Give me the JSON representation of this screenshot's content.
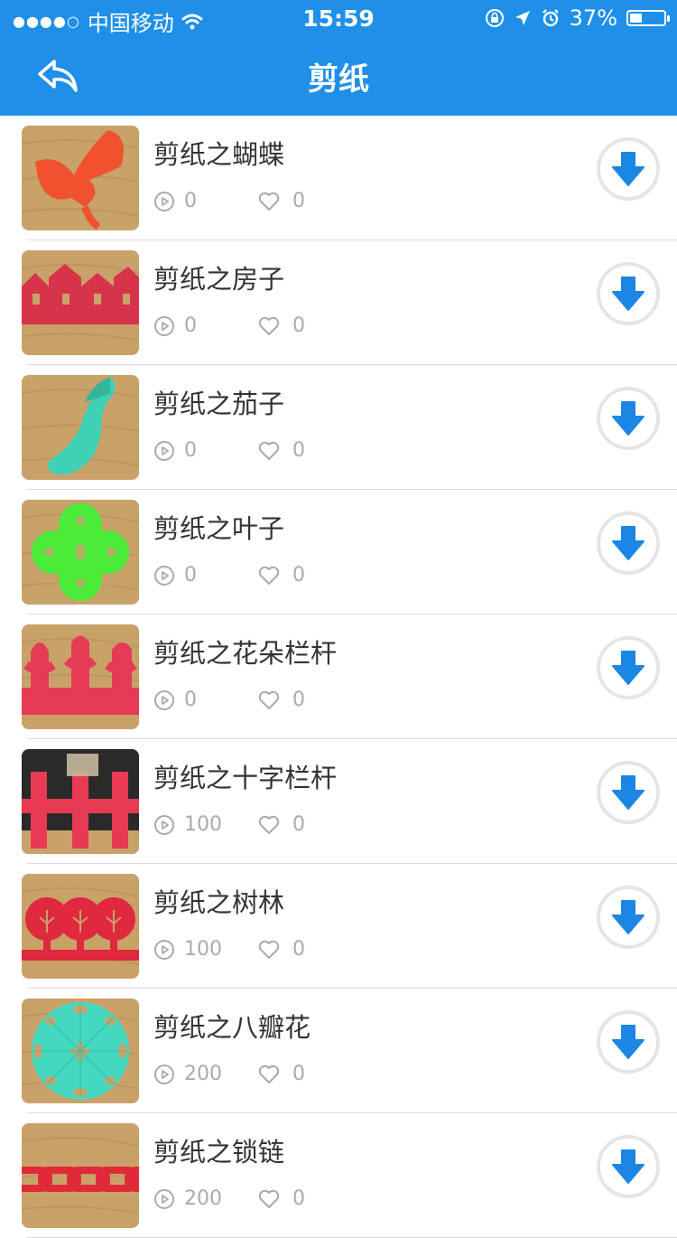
{
  "status_bar": {
    "carrier": "中国移动",
    "time": "15:59",
    "battery_percent": "37%",
    "battery_level": 0.37,
    "signal_dots": "●●●●○"
  },
  "nav": {
    "title": "剪纸",
    "back_icon": "back-arrow-icon"
  },
  "items": [
    {
      "title": "剪纸之蝴蝶",
      "plays": "0",
      "likes": "0",
      "thumb": "butterfly",
      "color": "#f0522f"
    },
    {
      "title": "剪纸之房子",
      "plays": "0",
      "likes": "0",
      "thumb": "house",
      "color": "#d7334a"
    },
    {
      "title": "剪纸之茄子",
      "plays": "0",
      "likes": "0",
      "thumb": "eggplant",
      "color": "#3fd1b6"
    },
    {
      "title": "剪纸之叶子",
      "plays": "0",
      "likes": "0",
      "thumb": "leaf",
      "color": "#4cec3b"
    },
    {
      "title": "剪纸之花朵栏杆",
      "plays": "0",
      "likes": "0",
      "thumb": "flower-fence",
      "color": "#e53b55"
    },
    {
      "title": "剪纸之十字栏杆",
      "plays": "100",
      "likes": "0",
      "thumb": "cross-fence",
      "color": "#e83a52"
    },
    {
      "title": "剪纸之树林",
      "plays": "100",
      "likes": "0",
      "thumb": "trees",
      "color": "#e0283e"
    },
    {
      "title": "剪纸之八瓣花",
      "plays": "200",
      "likes": "0",
      "thumb": "eight-petal",
      "color": "#42d9c0"
    },
    {
      "title": "剪纸之锁链",
      "plays": "200",
      "likes": "0",
      "thumb": "chain",
      "color": "#e02a3a"
    }
  ],
  "colors": {
    "primary": "#1f8fe8",
    "download": "#1b86e3",
    "meta": "#aaaaaa"
  }
}
